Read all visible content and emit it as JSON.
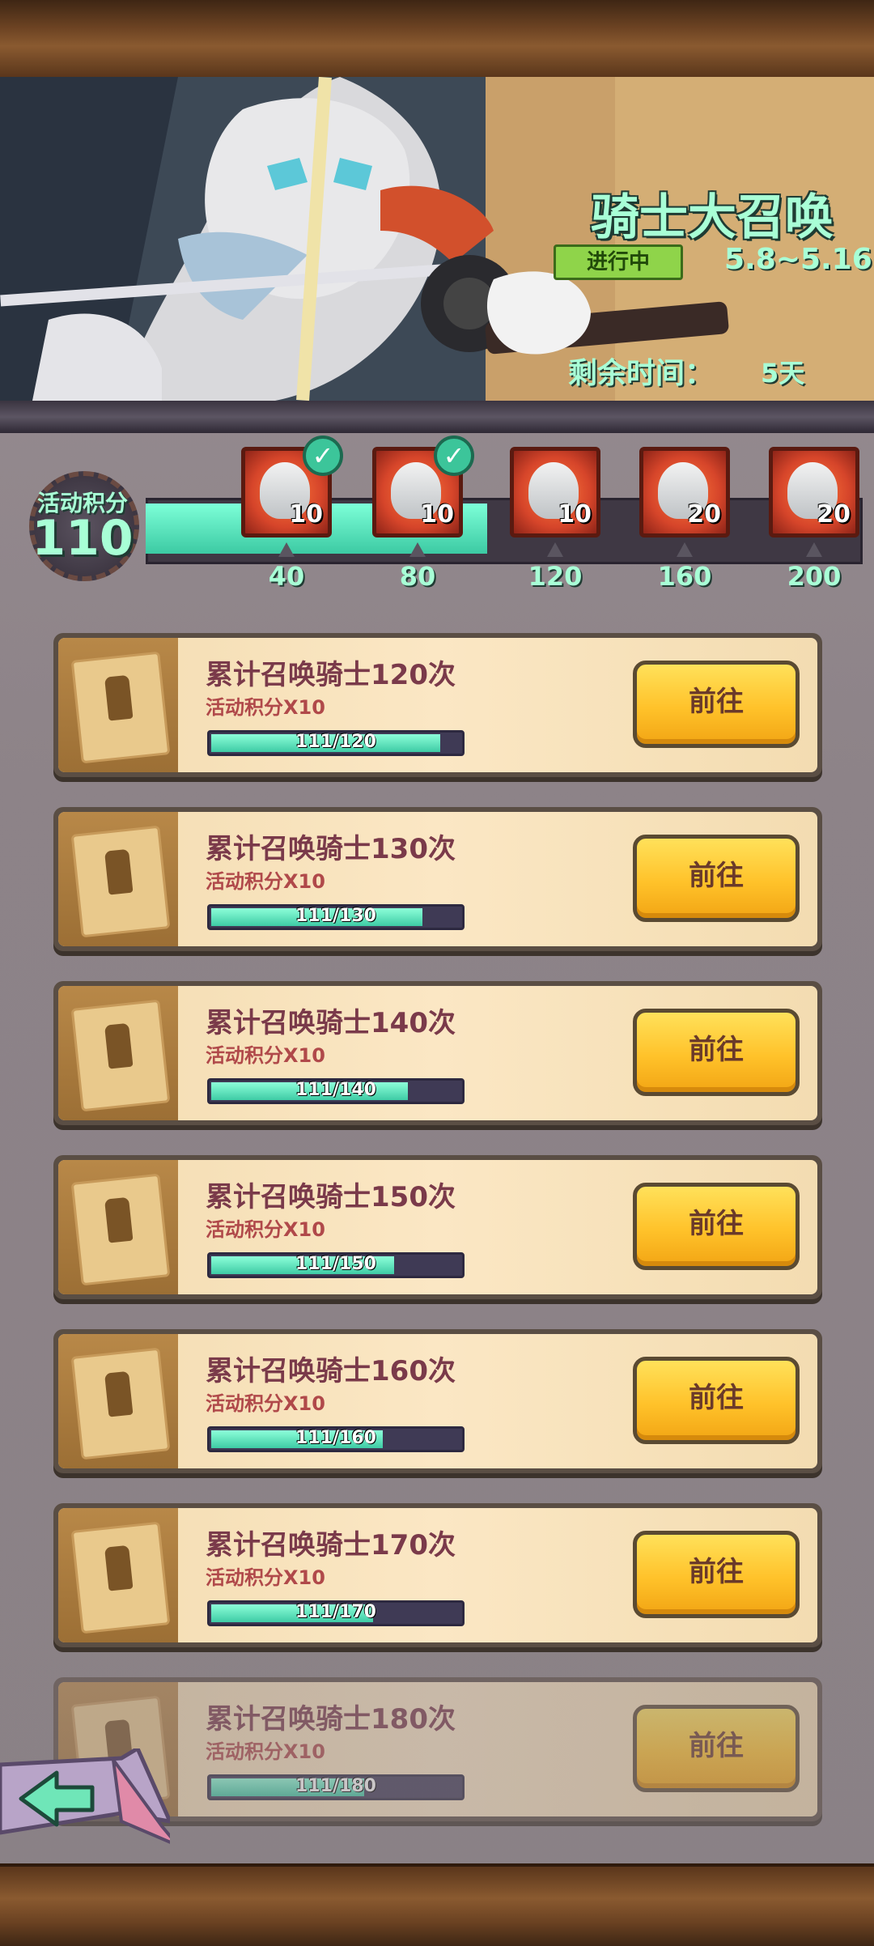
{
  "banner": {
    "title": "骑士大召唤",
    "status": "进行中",
    "date_range": "5.8~5.16",
    "remaining_label": "剩余时间：",
    "remaining_value": "5天"
  },
  "points": {
    "label": "活动积分",
    "value": "110",
    "progress_fraction": 0.48,
    "rewards": [
      {
        "threshold": "40",
        "count": "10",
        "claimed": true
      },
      {
        "threshold": "80",
        "count": "10",
        "claimed": true
      },
      {
        "threshold": "120",
        "count": "10",
        "claimed": false
      },
      {
        "threshold": "160",
        "count": "20",
        "claimed": false
      },
      {
        "threshold": "200",
        "count": "20",
        "claimed": false
      }
    ]
  },
  "tasks": [
    {
      "title": "累计召唤骑士120次",
      "reward": "活动积分X10",
      "progress": "111/120",
      "fraction": 0.925,
      "button": "前往"
    },
    {
      "title": "累计召唤骑士130次",
      "reward": "活动积分X10",
      "progress": "111/130",
      "fraction": 0.854,
      "button": "前往"
    },
    {
      "title": "累计召唤骑士140次",
      "reward": "活动积分X10",
      "progress": "111/140",
      "fraction": 0.793,
      "button": "前往"
    },
    {
      "title": "累计召唤骑士150次",
      "reward": "活动积分X10",
      "progress": "111/150",
      "fraction": 0.74,
      "button": "前往"
    },
    {
      "title": "累计召唤骑士160次",
      "reward": "活动积分X10",
      "progress": "111/160",
      "fraction": 0.694,
      "button": "前往"
    },
    {
      "title": "累计召唤骑士170次",
      "reward": "活动积分X10",
      "progress": "111/170",
      "fraction": 0.653,
      "button": "前往"
    },
    {
      "title": "累计召唤骑士180次",
      "reward": "活动积分X10",
      "progress": "111/180",
      "fraction": 0.617,
      "button": "前往"
    }
  ],
  "colors": {
    "accent_text": "#a8ffd6",
    "progress_fill": "#3ccaa3",
    "button_yellow": "#ffc22a",
    "status_green": "#8fd44a"
  },
  "icons": {
    "back": "back-arrow-icon",
    "claimed": "check-icon",
    "reward": "knight-portrait-icon",
    "task": "scroll-icon"
  }
}
